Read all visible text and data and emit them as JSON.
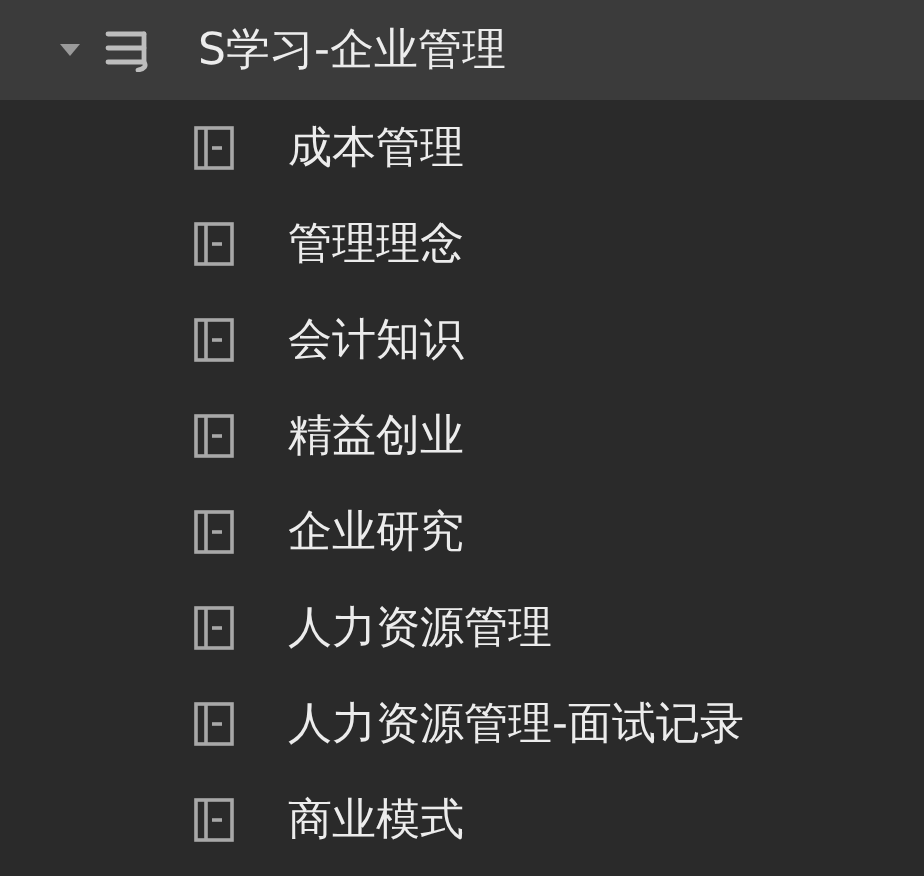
{
  "tree": [
    {
      "label": "S学习-企业管理",
      "expanded": true,
      "selected": true,
      "children": [
        {
          "label": "成本管理",
          "selected": false
        },
        {
          "label": "管理理念",
          "selected": false
        },
        {
          "label": "会计知识",
          "selected": false
        },
        {
          "label": "精益创业",
          "selected": false
        },
        {
          "label": "企业研究",
          "selected": false
        },
        {
          "label": "人力资源管理",
          "selected": false
        },
        {
          "label": "人力资源管理-面试记录",
          "selected": false
        },
        {
          "label": "商业模式",
          "selected": false
        }
      ]
    }
  ]
}
